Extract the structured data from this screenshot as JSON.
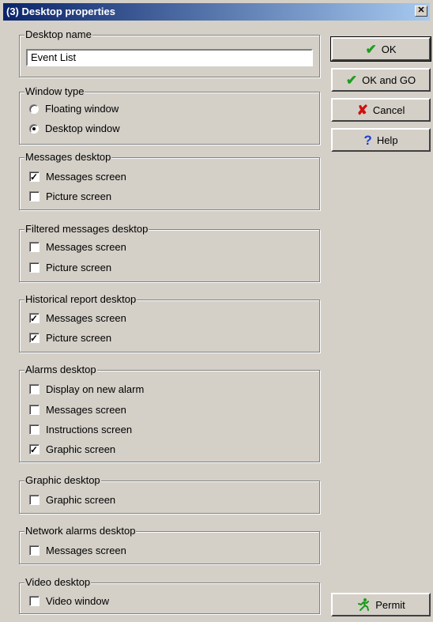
{
  "window": {
    "title": "(3)  Desktop properties",
    "close_label": "✕"
  },
  "desktop_name": {
    "label": "Desktop name",
    "value": "Event List"
  },
  "window_type": {
    "label": "Window type",
    "options": [
      {
        "label": "Floating window",
        "selected": false
      },
      {
        "label": "Desktop window",
        "selected": true
      }
    ]
  },
  "groups": {
    "messages": {
      "label": "Messages desktop",
      "items": [
        {
          "label": "Messages screen",
          "checked": true
        },
        {
          "label": "Picture screen",
          "checked": false
        }
      ]
    },
    "filtered": {
      "label": "Filtered messages desktop",
      "items": [
        {
          "label": "Messages screen",
          "checked": false
        },
        {
          "label": "Picture screen",
          "checked": false
        }
      ]
    },
    "historical": {
      "label": "Historical report desktop",
      "items": [
        {
          "label": "Messages screen",
          "checked": true
        },
        {
          "label": "Picture screen",
          "checked": true
        }
      ]
    },
    "alarms": {
      "label": "Alarms desktop",
      "items": [
        {
          "label": "Display on new alarm",
          "checked": false
        },
        {
          "label": "Messages screen",
          "checked": false
        },
        {
          "label": "Instructions screen",
          "checked": false
        },
        {
          "label": "Graphic screen",
          "checked": true
        }
      ]
    },
    "graphic": {
      "label": "Graphic desktop",
      "items": [
        {
          "label": "Graphic screen",
          "checked": false
        }
      ]
    },
    "network": {
      "label": "Network alarms desktop",
      "items": [
        {
          "label": "Messages screen",
          "checked": false
        }
      ]
    },
    "video": {
      "label": "Video desktop",
      "items": [
        {
          "label": "Video window",
          "checked": false
        }
      ]
    }
  },
  "buttons": {
    "ok": "OK",
    "ok_and_go": "OK and GO",
    "cancel": "Cancel",
    "help": "Help",
    "permit": "Permit"
  },
  "icons": {
    "ok": "checkmark-icon",
    "ok_and_go": "checkmark-icon",
    "cancel": "cross-icon",
    "help": "question-icon",
    "permit": "running-man-icon"
  },
  "colors": {
    "titlebar_start": "#0a246a",
    "titlebar_end": "#a6caf0",
    "face": "#d4d0c8"
  }
}
